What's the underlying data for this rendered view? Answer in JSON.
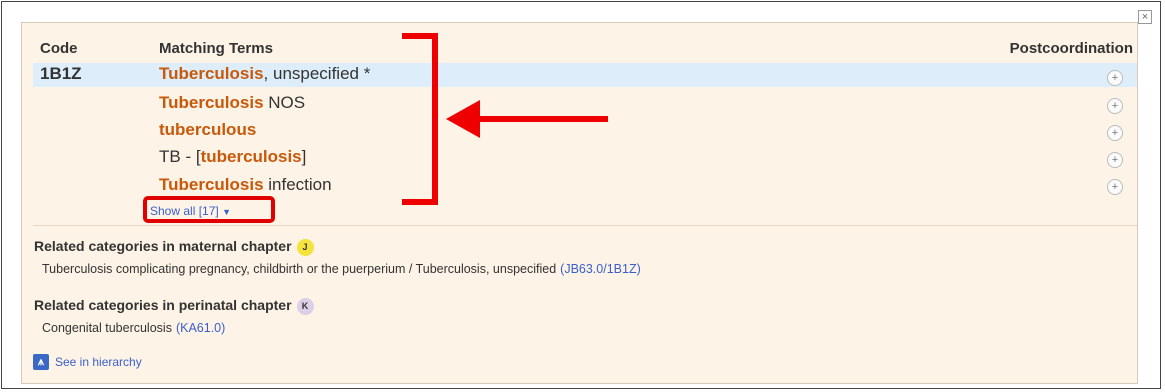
{
  "dialog": {
    "close_label": "×"
  },
  "table": {
    "headers": {
      "code": "Code",
      "terms": "Matching Terms",
      "postcoordination": "Postcoordination"
    },
    "code": "1B1Z",
    "rows": [
      {
        "bold": "Tuberculosis",
        "rest": ", unspecified *"
      },
      {
        "bold": "Tuberculosis",
        "rest": " NOS"
      },
      {
        "bold": "tuberculous",
        "rest": ""
      },
      {
        "pre": "TB - [",
        "bold": "tuberculosis",
        "rest": "]"
      },
      {
        "bold": "Tuberculosis",
        "rest": " infection"
      }
    ],
    "plus_label": "+",
    "show_all": "Show all [17]"
  },
  "related": {
    "maternal": {
      "title": "Related categories in maternal chapter",
      "badge": "J",
      "item_text": "Tuberculosis complicating pregnancy, childbirth or the puerperium / Tuberculosis, unspecified",
      "item_code": "(JB63.0/1B1Z)"
    },
    "perinatal": {
      "title": "Related categories in perinatal chapter",
      "badge": "K",
      "item_text": "Congenital tuberculosis",
      "item_code": "(KA61.0)"
    }
  },
  "hierarchy": {
    "icon_label": "⩚",
    "link": "See in hierarchy"
  },
  "colors": {
    "term_highlight": "#c8590a",
    "link": "#3a5fcd",
    "annotation": "#ee0000",
    "selected_row": "#ddeefa",
    "panel": "#fdf3e6"
  }
}
